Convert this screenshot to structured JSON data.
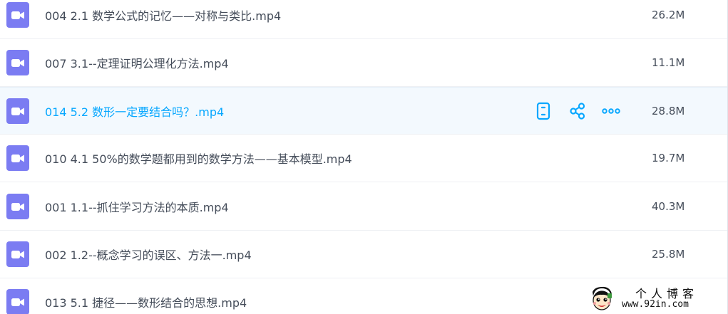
{
  "files": [
    {
      "name": "004 2.1 数学公式的记忆——对称与类比.mp4",
      "size": "26.2M",
      "hovered": false,
      "icon": "video-file-icon"
    },
    {
      "name": "007 3.1--定理证明公理化方法.mp4",
      "size": "11.1M",
      "hovered": false,
      "icon": "video-file-icon"
    },
    {
      "name": "014 5.2 数形一定要结合吗？.mp4",
      "size": "28.8M",
      "hovered": true,
      "icon": "video-file-icon"
    },
    {
      "name": "010 4.1 50%的数学题都用到的数学方法——基本模型.mp4",
      "size": "19.7M",
      "hovered": false,
      "icon": "video-file-icon"
    },
    {
      "name": "001 1.1--抓住学习方法的本质.mp4",
      "size": "40.3M",
      "hovered": false,
      "icon": "video-file-icon"
    },
    {
      "name": "002 1.2--概念学习的误区、方法一.mp4",
      "size": "25.8M",
      "hovered": false,
      "icon": "video-file-icon"
    },
    {
      "name": "013 5.1 捷径——数形结合的思想.mp4",
      "size": "",
      "hovered": false,
      "icon": "video-file-icon"
    }
  ],
  "row_actions": [
    "phone-icon",
    "share-icon",
    "more-icon"
  ],
  "watermark": {
    "title": "个人博客",
    "url": "www.92in.com"
  },
  "colors": {
    "icon_purple": "#7b7cf2",
    "accent_blue": "#06a7ff",
    "text": "#454d5a",
    "hover_bg": "#f3f9fe",
    "divider": "#eef0f4"
  }
}
